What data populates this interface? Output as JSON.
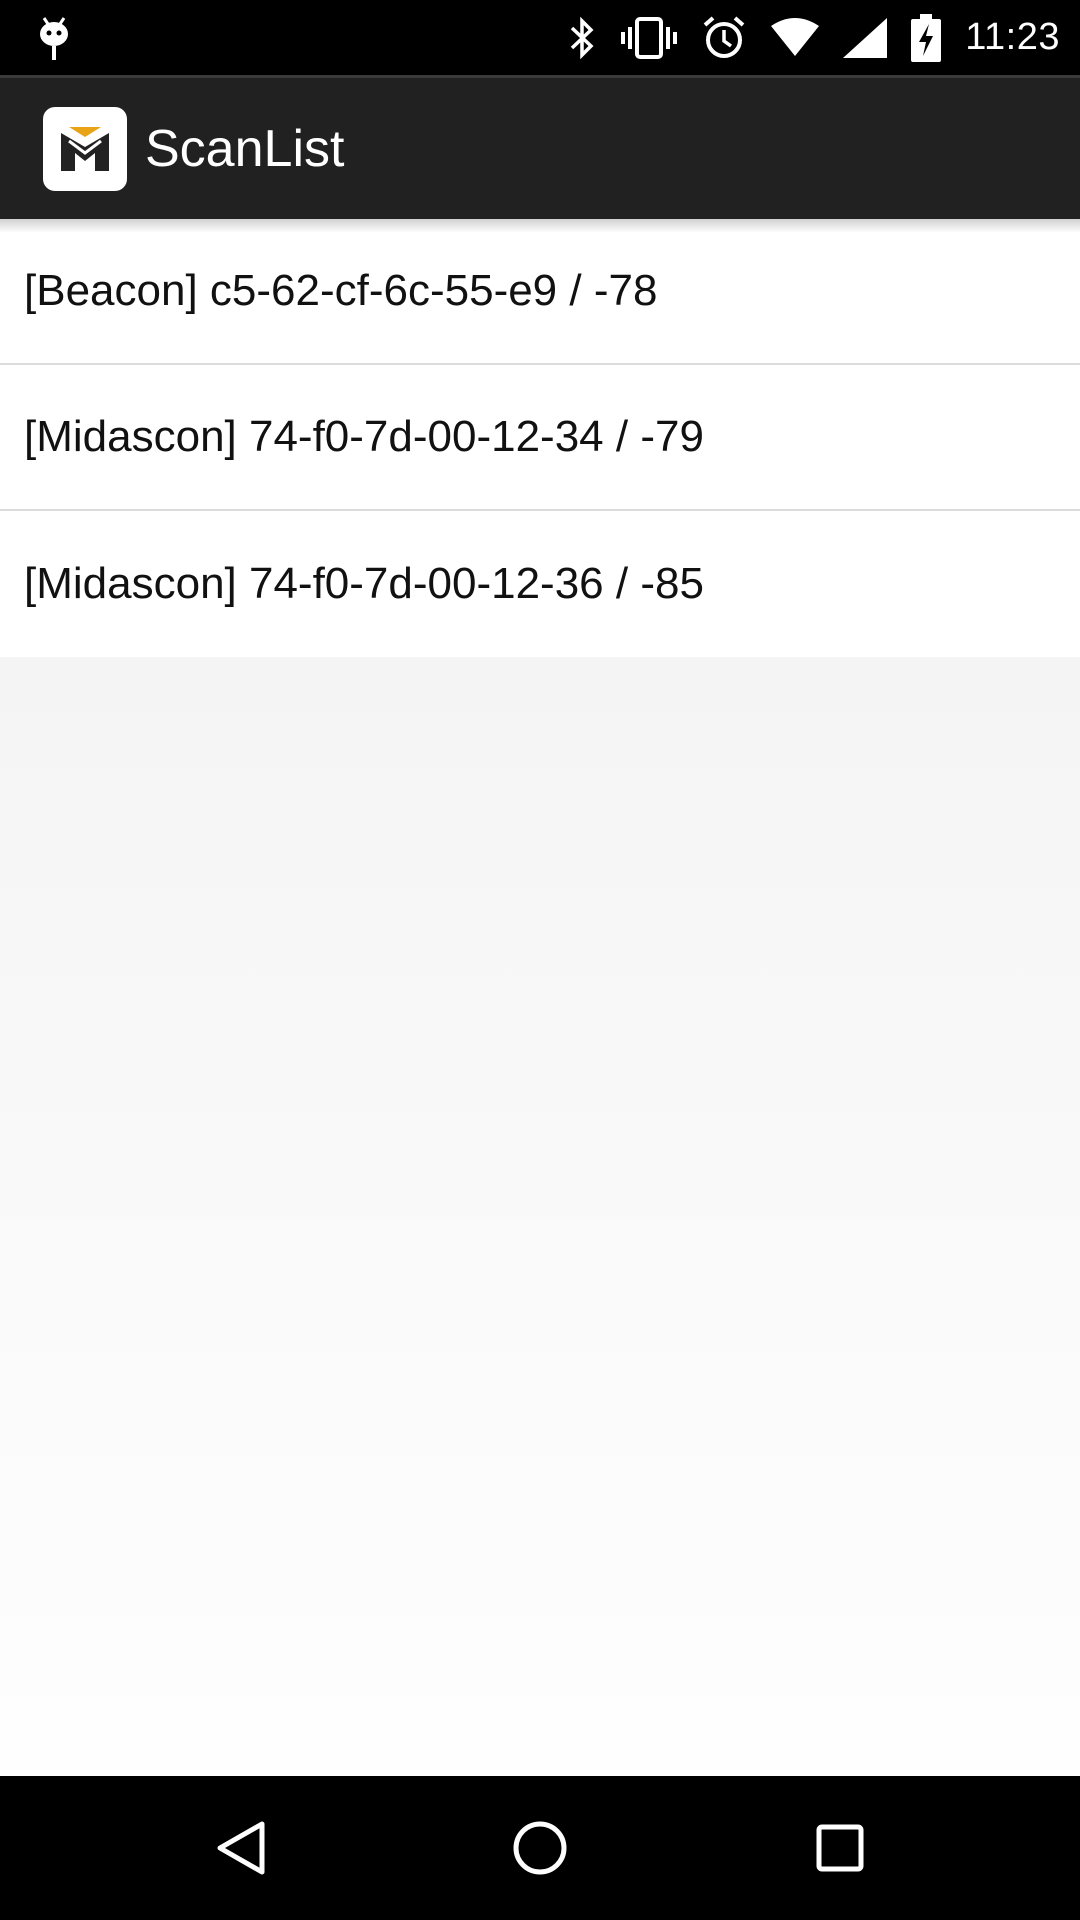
{
  "status_bar": {
    "time": "11:23",
    "icons": [
      "android-debug-icon",
      "bluetooth-icon",
      "vibrate-icon",
      "alarm-icon",
      "wifi-icon",
      "signal-icon",
      "battery-charging-icon"
    ]
  },
  "action_bar": {
    "title": "ScanList",
    "logo": "app-logo-icon"
  },
  "scan_list": {
    "items": [
      {
        "label": "[Beacon] c5-62-cf-6c-55-e9 / -78"
      },
      {
        "label": "[Midascon] 74-f0-7d-00-12-34 / -79"
      },
      {
        "label": "[Midascon] 74-f0-7d-00-12-36 / -85"
      }
    ]
  },
  "nav_bar": {
    "buttons": [
      "back-icon",
      "home-icon",
      "recents-icon"
    ]
  },
  "colors": {
    "action_bar": "#212121",
    "logo_accent": "#e8a317",
    "logo_dark": "#222222"
  }
}
